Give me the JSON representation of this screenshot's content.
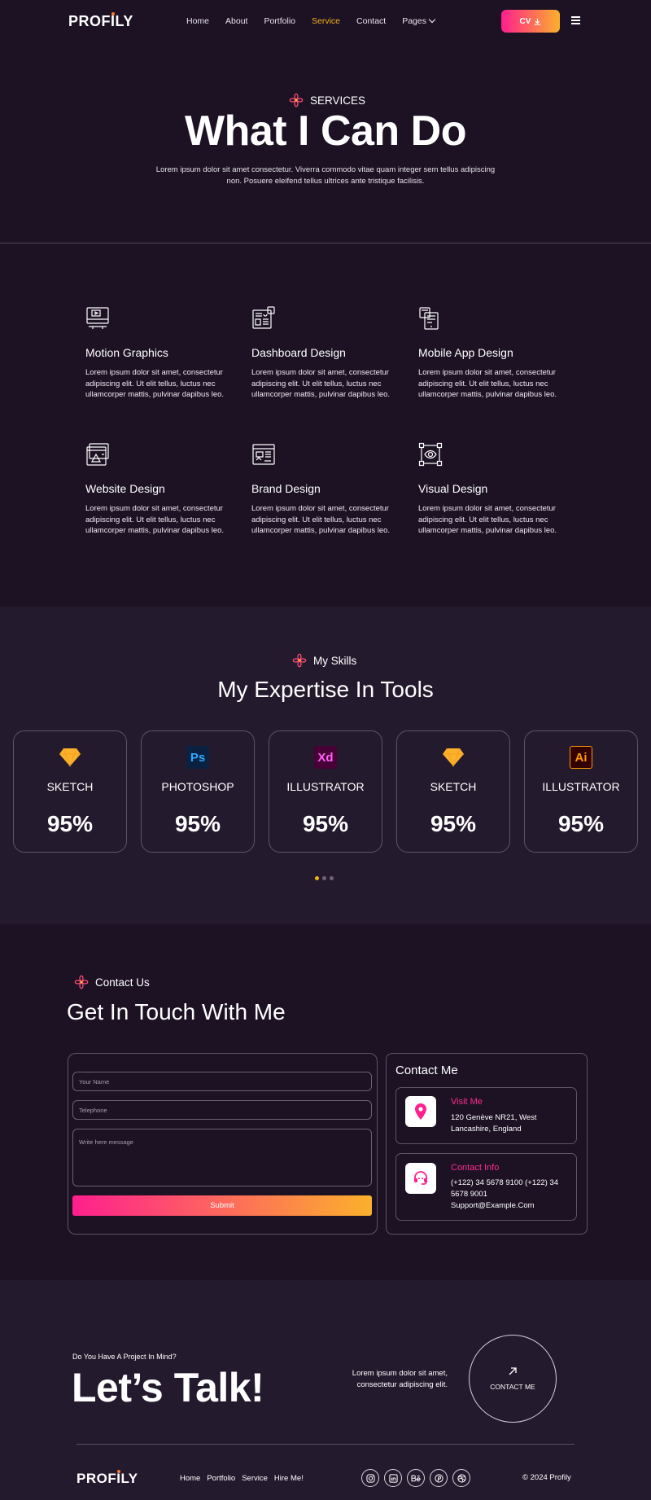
{
  "header": {
    "logo": "PROFILY",
    "nav": [
      "Home",
      "About",
      "Portfolio",
      "Service",
      "Contact",
      "Pages"
    ],
    "active": "Service",
    "cv_label": "CV"
  },
  "hero": {
    "eyebrow": "SERVICES",
    "title": "What I Can Do",
    "text": "Lorem ipsum dolor sit amet consectetur. Viverra commodo vitae quam integer sem tellus adipiscing non. Posuere eleifend tellus ultrices ante tristique facilisis."
  },
  "services": [
    {
      "title": "Motion Graphics",
      "icon": "motion-graphics-icon",
      "text": "Lorem ipsum dolor sit amet, consectetur adipiscing elit. Ut elit tellus, luctus nec ullamcorper mattis, pulvinar dapibus leo."
    },
    {
      "title": "Dashboard Design",
      "icon": "dashboard-icon",
      "text": "Lorem ipsum dolor sit amet, consectetur adipiscing elit. Ut elit tellus, luctus nec ullamcorper mattis, pulvinar dapibus leo."
    },
    {
      "title": "Mobile App Design",
      "icon": "mobile-app-icon",
      "text": "Lorem ipsum dolor sit amet, consectetur adipiscing elit. Ut elit tellus, luctus nec ullamcorper mattis, pulvinar dapibus leo."
    },
    {
      "title": "Website Design",
      "icon": "website-icon",
      "text": "Lorem ipsum dolor sit amet, consectetur adipiscing elit. Ut elit tellus, luctus nec ullamcorper mattis, pulvinar dapibus leo."
    },
    {
      "title": "Brand Design",
      "icon": "brand-icon",
      "text": "Lorem ipsum dolor sit amet, consectetur adipiscing elit. Ut elit tellus, luctus nec ullamcorper mattis, pulvinar dapibus leo."
    },
    {
      "title": "Visual Design",
      "icon": "visual-design-icon",
      "text": "Lorem ipsum dolor sit amet, consectetur adipiscing elit. Ut elit tellus, luctus nec ullamcorper mattis, pulvinar dapibus leo."
    }
  ],
  "skills": {
    "eyebrow": "My Skills",
    "title": "My Expertise In Tools",
    "cards": [
      {
        "name": "SKETCH",
        "percent": "95%",
        "icon": "sketch-icon"
      },
      {
        "name": "PHOTOSHOP",
        "percent": "95%",
        "icon": "photoshop-icon",
        "badge": "Ps"
      },
      {
        "name": "ILLUSTRATOR",
        "percent": "95%",
        "icon": "xd-icon",
        "badge": "Xd"
      },
      {
        "name": "SKETCH",
        "percent": "95%",
        "icon": "sketch-icon"
      },
      {
        "name": "ILLUSTRATOR",
        "percent": "95%",
        "icon": "illustrator-icon",
        "badge": "Ai"
      }
    ]
  },
  "contact": {
    "eyebrow": "Contact Us",
    "title": "Get In Touch With Me",
    "form": {
      "name_placeholder": "Your Name",
      "phone_placeholder": "Telephone",
      "message_placeholder": "Write here message",
      "submit": "Submit"
    },
    "panel_title": "Contact Me",
    "visit_title": "Visit Me",
    "visit_text": "120 Genève NR21, West Lancashire, England",
    "info_title": "Contact Info",
    "info_phones": "(+122) 34 5678 9100 (+122) 34 5678 9001",
    "info_email": "Support@Example.Com"
  },
  "footer": {
    "question": "Do You Have A Project In Mind?",
    "talk": "Let’s Talk!",
    "text": "Lorem ipsum dolor sit amet, consectetur adipiscing elit.",
    "contact_me": "CONTACT ME",
    "logo": "PROFILY",
    "nav": [
      "Home",
      "Portfolio",
      "Service",
      "Hire Me!"
    ],
    "copyright": "© 2024 Profily",
    "socials": [
      "instagram-icon",
      "linkedin-icon",
      "behance-icon",
      "pinterest-icon",
      "dribbble-icon"
    ]
  },
  "colors": {
    "accent_pink": "#ff1f8e",
    "accent_orange": "#fbb12c",
    "bg": "#1c1224",
    "bg_alt": "#241a2d"
  }
}
